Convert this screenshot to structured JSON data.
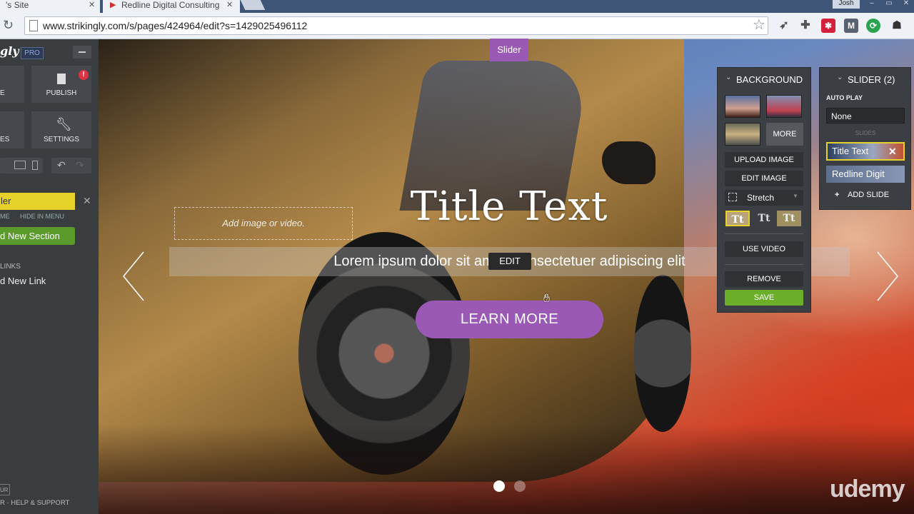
{
  "browser": {
    "tabs": [
      {
        "title": "'s Site"
      },
      {
        "title": "Redline Digital Consulting"
      }
    ],
    "user": "Josh",
    "url": "www.strikingly.com/s/pages/424964/edit?s=1429025496112"
  },
  "sidebar": {
    "logo": "gly",
    "pro_badge": "PRO",
    "tiles": [
      {
        "label": "E"
      },
      {
        "label": "PUBLISH",
        "alert": "!"
      },
      {
        "label": "ES"
      },
      {
        "label": "SETTINGS"
      }
    ],
    "section_name": "ler",
    "section_links": {
      "rename": "ME",
      "hide": "HIDE IN MENU"
    },
    "add_section": "d New Section",
    "links_heading": "LINKS",
    "add_link": "d New Link",
    "bottom_chip": "UR",
    "help": "R · HELP & SUPPORT"
  },
  "hero": {
    "section_tag": "Slider",
    "media_placeholder": "Add image or video.",
    "title": "Title Text",
    "subtitle": "Lorem ipsum dolor sit amet, consectetuer adipiscing elit",
    "edit_label": "EDIT",
    "cta": "LEARN MORE",
    "slides_total": 2,
    "active_slide": 1
  },
  "background_panel": {
    "heading": "BACKGROUND",
    "more": "MORE",
    "upload_image": "UPLOAD IMAGE",
    "edit_image": "EDIT IMAGE",
    "fit_mode": "Stretch",
    "text_styles": [
      "Tt",
      "Tt",
      "Tt"
    ],
    "use_video": "USE VIDEO",
    "remove": "REMOVE",
    "save": "SAVE"
  },
  "slider_panel": {
    "heading": "SLIDER (2)",
    "autoplay_label": "AUTO PLAY",
    "autoplay_value": "None",
    "slides_label": "SLIDES",
    "slides": [
      "Title Text",
      "Redline Digit"
    ],
    "add_slide": "ADD SLIDE"
  },
  "watermark": "udemy",
  "colors": {
    "accent": "#9b59b6",
    "save": "#6aae2a",
    "section_highlight": "#e6d22a"
  }
}
